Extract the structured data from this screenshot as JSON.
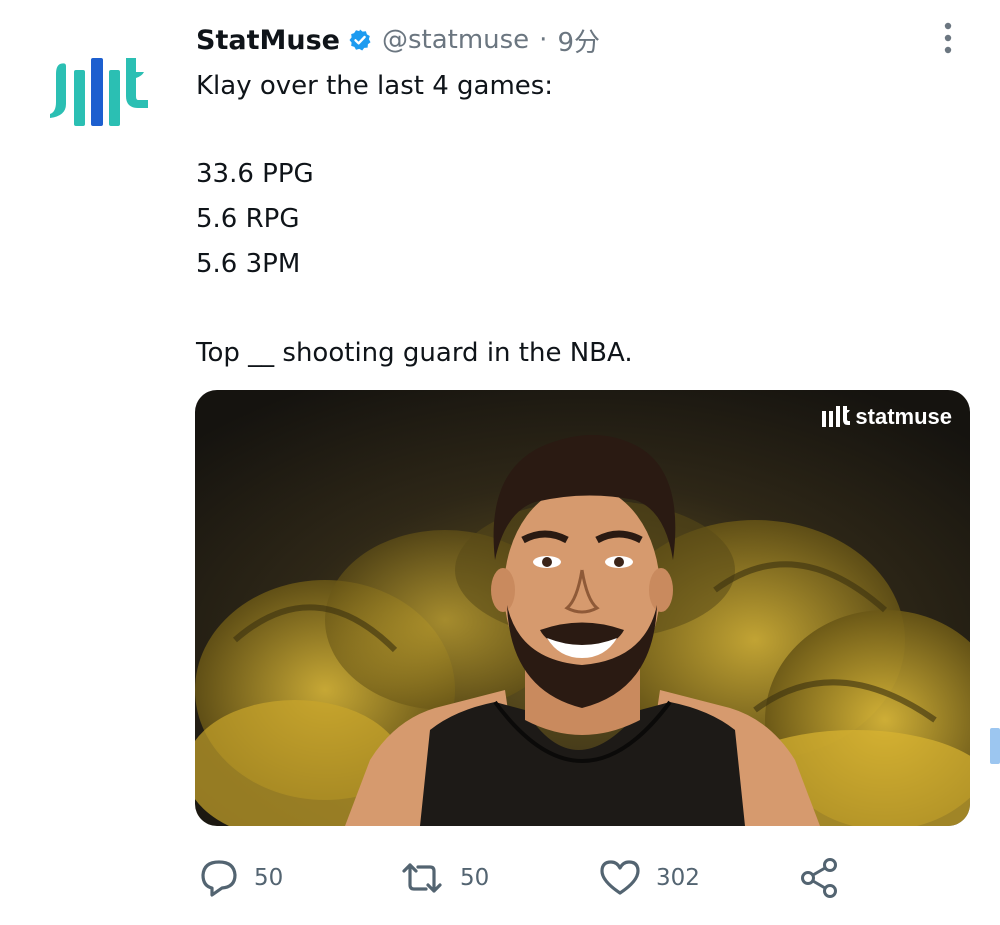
{
  "tweet": {
    "author": {
      "name": "StatMuse",
      "handle": "@statmuse",
      "verified": true,
      "avatar_icon": "statmuse-logo-icon"
    },
    "separator": "·",
    "time": "9分",
    "lines": [
      "Klay over the last 4 games:",
      "33.6 PPG",
      "5.6 RPG",
      "5.6 3PM",
      "Top __ shooting guard in the NBA."
    ],
    "media": {
      "watermark": "statmuse",
      "background_colors": [
        "#1a1712",
        "#c9a52b"
      ]
    }
  },
  "actions": {
    "reply_count": "50",
    "retweet_count": "50",
    "like_count": "302",
    "share_icon": "share-icon"
  },
  "colors": {
    "text": "#0f1419",
    "secondary": "#6b7680",
    "verified": "#1d9bf0",
    "logo_teal": "#2bbfb3",
    "logo_blue": "#1d5fcf"
  }
}
